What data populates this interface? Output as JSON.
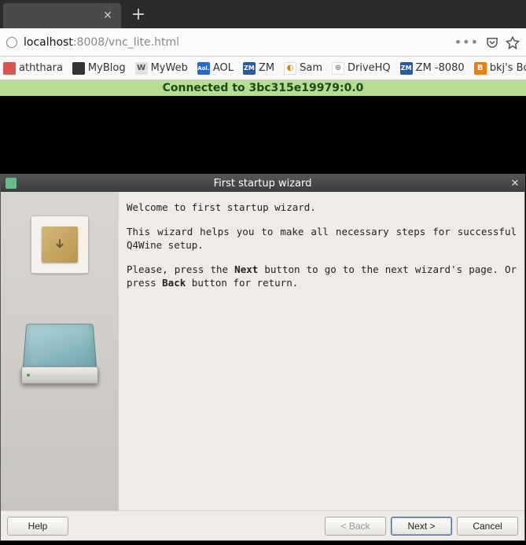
{
  "browser": {
    "url_host": "localhost",
    "url_rest": ":8008/vnc_lite.html",
    "bookmarks": [
      {
        "label": "aththara",
        "icon": "red"
      },
      {
        "label": "MyBlog",
        "icon": "dark"
      },
      {
        "label": "MyWeb",
        "icon": "w",
        "glyph": "W"
      },
      {
        "label": "AOL",
        "icon": "aol",
        "glyph": "Aol."
      },
      {
        "label": "ZM",
        "icon": "zm",
        "glyph": "ZM"
      },
      {
        "label": "Sam",
        "icon": "sam",
        "glyph": "◐"
      },
      {
        "label": "DriveHQ",
        "icon": "drive",
        "glyph": "⊕"
      },
      {
        "label": "ZM -8080",
        "icon": "zm",
        "glyph": "ZM"
      },
      {
        "label": "bkj's Bo",
        "icon": "blog",
        "glyph": "B"
      }
    ]
  },
  "vnc": {
    "connected_text": "Connected to 3bc315e19979:0.0"
  },
  "wizard": {
    "title": "First startup wizard",
    "welcome": "Welcome to first startup wizard.",
    "desc": "This wizard helps you to make all necessary steps for successful Q4Wine setup.",
    "instr_pre": "Please, press the ",
    "instr_next": "Next",
    "instr_mid": " button to go to the next wizard's page. Or press ",
    "instr_back": "Back",
    "instr_post": " button for return.",
    "buttons": {
      "help": "Help",
      "back": "< Back",
      "next": "Next >",
      "cancel": "Cancel"
    }
  }
}
